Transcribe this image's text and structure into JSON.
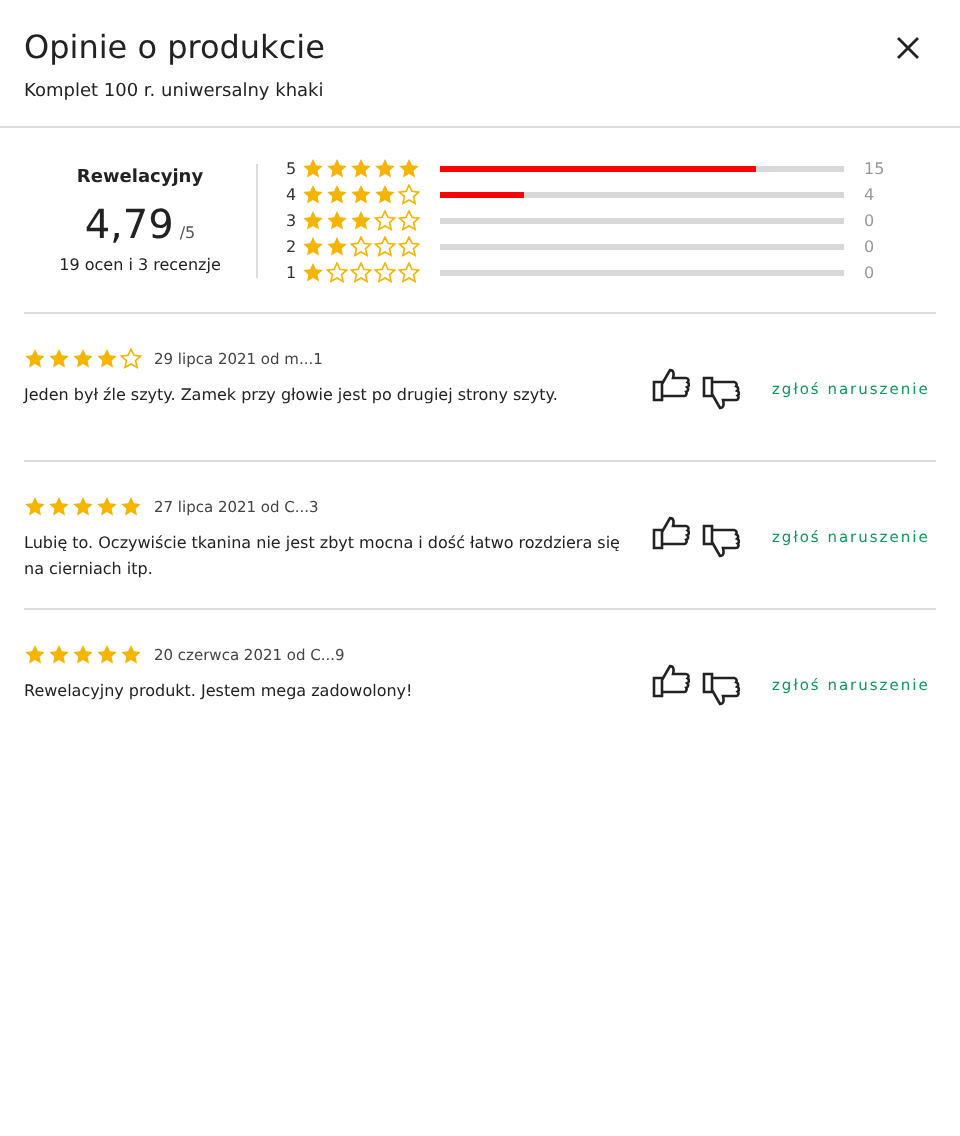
{
  "header": {
    "title": "Opinie o produkcie",
    "subtitle": "Komplet 100 r. uniwersalny khaki"
  },
  "summary": {
    "verdict": "Rewelacyjny",
    "score": "4,79",
    "scale": "/5",
    "counts": "19 ocen i 3 recenzje"
  },
  "histogram": [
    {
      "label": "5",
      "stars": 5,
      "level": 0.78,
      "count": "15"
    },
    {
      "label": "4",
      "stars": 4,
      "level": 0.21,
      "count": "4"
    },
    {
      "label": "3",
      "stars": 3,
      "count": "0"
    },
    {
      "label": "2",
      "stars": 2,
      "count": "0"
    },
    {
      "label": "1",
      "stars": 1,
      "count": "0"
    }
  ],
  "reviews": [
    {
      "stars": 4,
      "meta": "29 lipca 2021 od m...1",
      "text": "Jeden był źle szyty. Zamek przy głowie jest po drugiej strony szyty.",
      "report": "zgłoś naruszenie"
    },
    {
      "stars": 5,
      "meta": "27 lipca 2021 od C...3",
      "text": "Lubię to. Oczywiście tkanina nie jest zbyt mocna i dość łatwo rozdziera się na cierniach itp.",
      "report": "zgłoś naruszenie"
    },
    {
      "stars": 5,
      "meta": "20 czerwca 2021 od C...9",
      "text": "Rewelacyjny produkt. Jestem mega zadowolony!",
      "report": "zgłoś naruszenie"
    }
  ]
}
